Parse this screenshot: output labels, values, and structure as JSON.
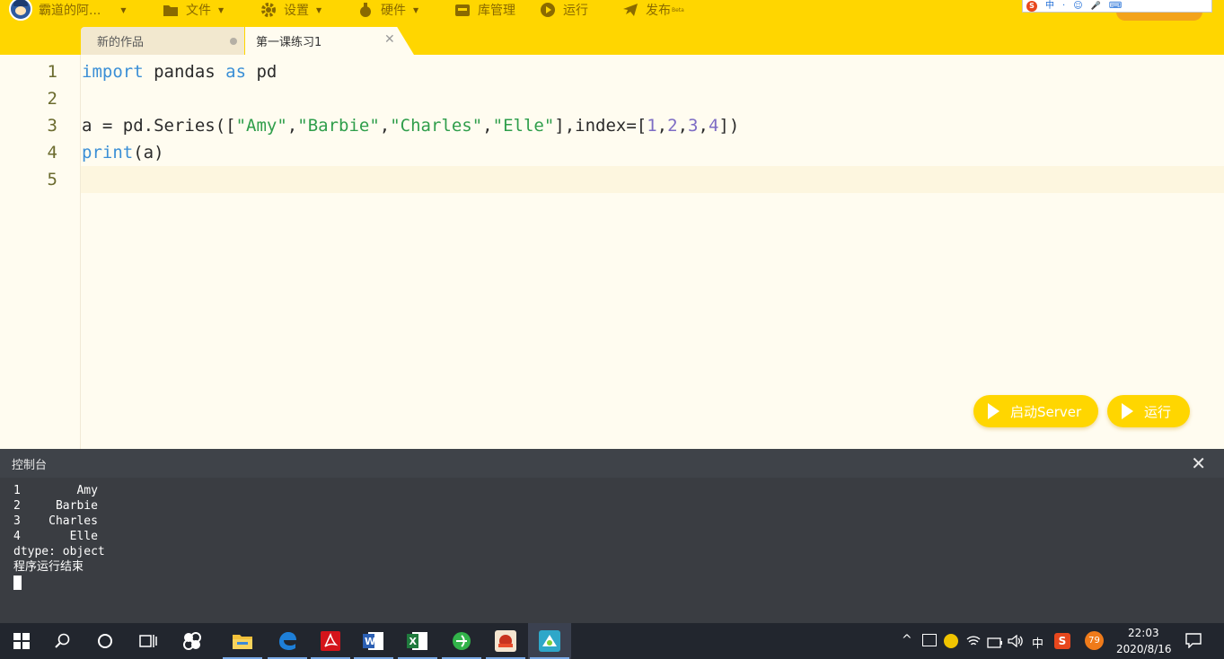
{
  "menubar": {
    "user_label": "霸道的阿...",
    "items": [
      {
        "label": "文件",
        "icon": "folder-icon"
      },
      {
        "label": "设置",
        "icon": "gear-icon"
      },
      {
        "label": "硬件",
        "icon": "hardware-icon"
      },
      {
        "label": "库管理",
        "icon": "library-icon"
      },
      {
        "label": "运行",
        "icon": "run-icon"
      },
      {
        "label": "发布",
        "icon": "paper-plane-icon",
        "badge": "Beta"
      }
    ],
    "ime": [
      "中",
      "·",
      "☺",
      "🎤",
      "⌨"
    ]
  },
  "tabs": [
    {
      "label": "新的作品",
      "active": false
    },
    {
      "label": "第一课练习1",
      "active": true
    }
  ],
  "editor": {
    "line_numbers": [
      "1",
      "2",
      "3",
      "4",
      "5"
    ],
    "lines": [
      "import pandas as pd",
      "",
      "a = pd.Series([\"Amy\",\"Barbie\",\"Charles\",\"Elle\"],index=[1,2,3,4])",
      "print(a)",
      ""
    ],
    "active_line": 5
  },
  "buttons": {
    "start_server": "启动Server",
    "run": "运行"
  },
  "console": {
    "title": "控制台",
    "output": [
      "1        Amy",
      "2     Barbie",
      "3    Charles",
      "4       Elle",
      "dtype: object",
      "程序运行结束"
    ]
  },
  "taskbar": {
    "time": "22:03",
    "date": "2020/8/16",
    "ime_label": "中",
    "badge_count": "79",
    "apps": [
      "windows-start-icon",
      "search-icon",
      "cortana-icon",
      "task-view-icon",
      "pinwheel-app-icon",
      "file-explorer-icon",
      "edge-icon",
      "acrobat-icon",
      "word-icon",
      "excel-icon",
      "green-app-icon",
      "game-app-icon",
      "mind-ide-icon"
    ]
  }
}
